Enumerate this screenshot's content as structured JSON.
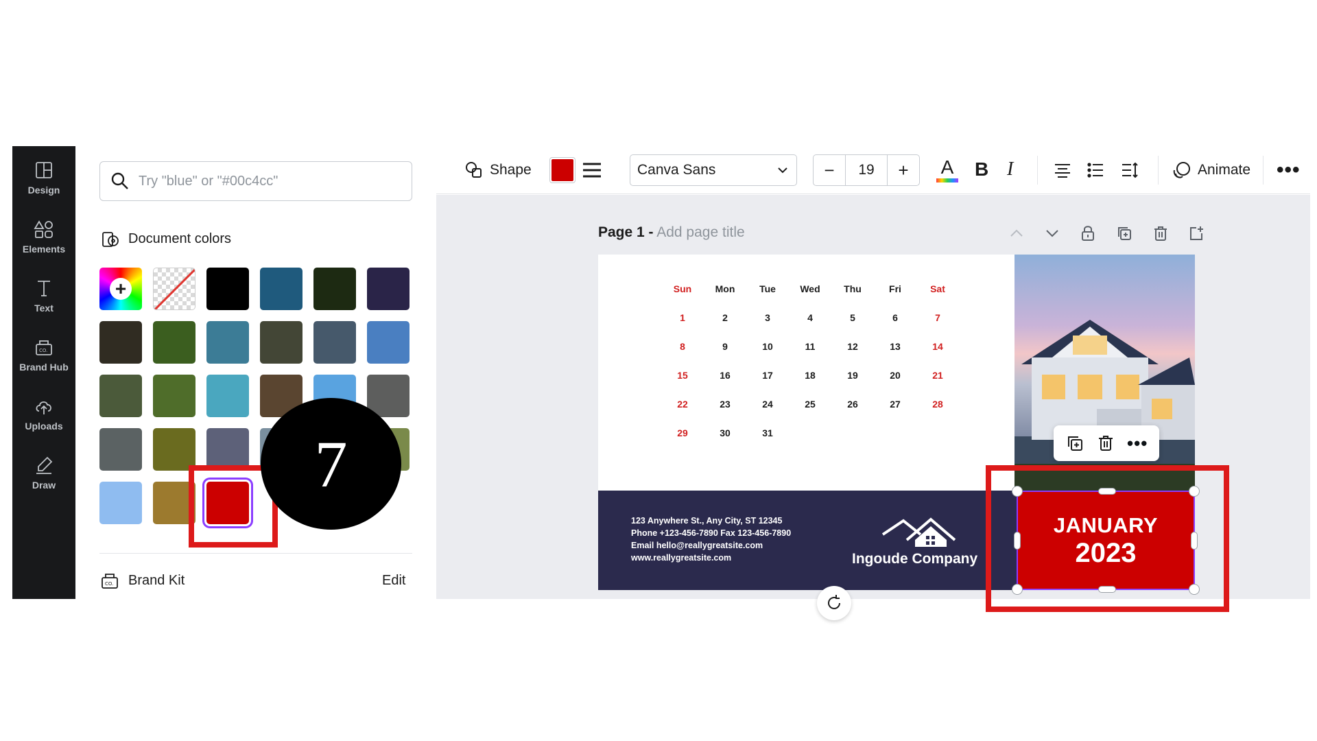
{
  "rail": {
    "items": [
      {
        "label": "Design",
        "icon": "layout-icon"
      },
      {
        "label": "Elements",
        "icon": "shapes-icon"
      },
      {
        "label": "Text",
        "icon": "text-icon"
      },
      {
        "label": "Brand Hub",
        "icon": "brand-icon"
      },
      {
        "label": "Uploads",
        "icon": "cloud-upload-icon"
      },
      {
        "label": "Draw",
        "icon": "pen-icon"
      }
    ]
  },
  "panel": {
    "search_placeholder": "Try \"blue\" or \"#00c4cc\"",
    "document_colors_title": "Document colors",
    "add_color_symbol": "+",
    "swatches": [
      [
        "#000000",
        "#1f5a7d",
        "#1d2a12",
        "#2a2448"
      ],
      [
        "#302c22",
        "#3b5e1f",
        "#3c7c96",
        "#434636",
        "#46596b",
        "#4a7fc1"
      ],
      [
        "#4b5a3a",
        "#4f6d2a",
        "#4aa7bf",
        "#5a4530",
        "#59a3e0",
        "#5d5e5d"
      ],
      [
        "#5b6263",
        "#6a6b1f",
        "#5d6179",
        "#7a8f9e",
        "#6e8a3f",
        "#7a8a4a"
      ],
      [
        "#8fbcf0",
        "#9c7a2e",
        "#cc0000"
      ]
    ],
    "selected_color": "#cc0000",
    "brand_kit_title": "Brand Kit",
    "brand_kit_edit": "Edit"
  },
  "overlay": {
    "step_number": "7",
    "highlight_color": "#dd1a1a"
  },
  "toolbar": {
    "shape_label": "Shape",
    "fill_color": "#cc0000",
    "font_name": "Canva Sans",
    "font_size": "19",
    "decrease_symbol": "−",
    "increase_symbol": "+",
    "text_color_glyph": "A",
    "bold_glyph": "B",
    "italic_glyph": "I",
    "animate_label": "Animate",
    "more_glyph": "•••"
  },
  "page": {
    "label": "Page 1 -",
    "title_placeholder": "Add page title"
  },
  "calendar": {
    "weekdays": [
      "Sun",
      "Mon",
      "Tue",
      "Wed",
      "Thu",
      "Fri",
      "Sat"
    ],
    "weeks": [
      [
        "1",
        "2",
        "3",
        "4",
        "5",
        "6",
        "7"
      ],
      [
        "8",
        "9",
        "10",
        "11",
        "12",
        "13",
        "14"
      ],
      [
        "15",
        "16",
        "17",
        "18",
        "19",
        "20",
        "21"
      ],
      [
        "22",
        "23",
        "24",
        "25",
        "26",
        "27",
        "28"
      ],
      [
        "29",
        "30",
        "31",
        "",
        "",
        "",
        ""
      ]
    ],
    "contact_lines": [
      "123 Anywhere St., Any City, ST 12345",
      "Phone +123-456-7890  Fax 123-456-7890",
      "Email hello@reallygreatsite.com",
      "www.reallygreatsite.com"
    ],
    "company_name": "Ingoude Company",
    "month": "JANUARY",
    "year": "2023",
    "box_color": "#cc0000",
    "band_color": "#2b2a4d"
  },
  "float_menu": {
    "more_glyph": "•••"
  }
}
